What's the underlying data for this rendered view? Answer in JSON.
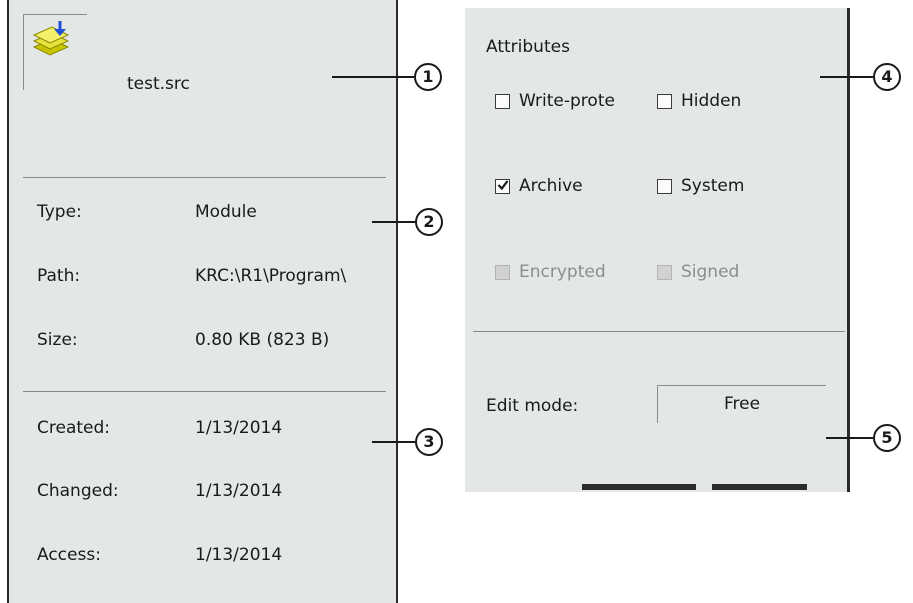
{
  "file": {
    "name": "test.src",
    "icon": "module-file-icon"
  },
  "properties": [
    {
      "label": "Type:",
      "value": "Module"
    },
    {
      "label": "Path:",
      "value": "KRC:\\R1\\Program\\"
    },
    {
      "label": "Size:",
      "value": "0.80 KB (823 B)"
    }
  ],
  "dates": [
    {
      "label": "Created:",
      "value": "1/13/2014"
    },
    {
      "label": "Changed:",
      "value": "1/13/2014"
    },
    {
      "label": "Access:",
      "value": "1/13/2014"
    }
  ],
  "attributes": {
    "title": "Attributes",
    "items": [
      {
        "label": "Write-prote",
        "checked": false,
        "enabled": true
      },
      {
        "label": "Hidden",
        "checked": false,
        "enabled": true
      },
      {
        "label": "Archive",
        "checked": true,
        "enabled": true
      },
      {
        "label": "System",
        "checked": false,
        "enabled": true
      },
      {
        "label": "Encrypted",
        "checked": false,
        "enabled": false
      },
      {
        "label": "Signed",
        "checked": false,
        "enabled": false
      }
    ]
  },
  "edit_mode": {
    "label": "Edit mode:",
    "value": "Free"
  },
  "callouts": [
    "1",
    "2",
    "3",
    "4",
    "5"
  ]
}
